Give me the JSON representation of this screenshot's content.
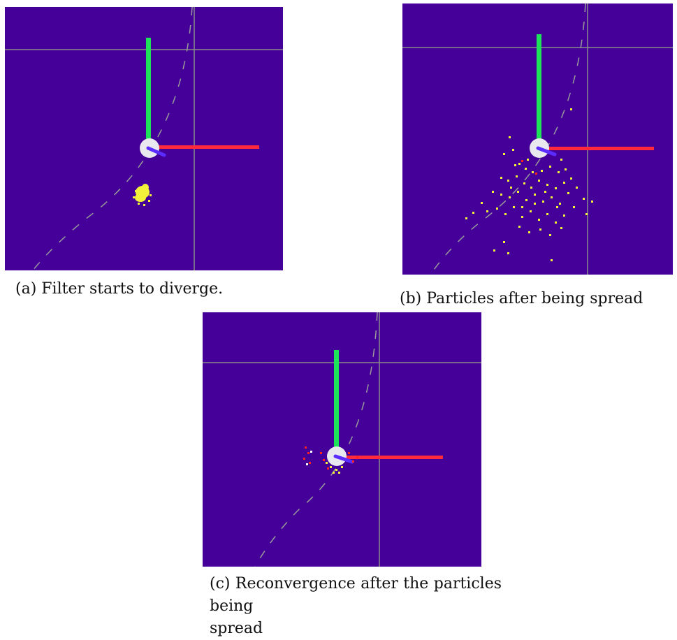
{
  "figure": {
    "colors": {
      "background": "#440099",
      "grid": "#8a8a8a",
      "trajectory": "#9a9a9a",
      "axis_vertical": "#1de25a",
      "axis_horizontal": "#ff2a3c",
      "robot_body": "#e8e8ee",
      "heading": "#5a2cff",
      "particle": "#f2f23a",
      "particle_red": "#ff2020"
    },
    "panels": [
      {
        "id": "a",
        "caption": "(a) Filter starts to diverge."
      },
      {
        "id": "b",
        "caption": "(b) Particles after being spread"
      },
      {
        "id": "c",
        "caption_line1": "(c) Reconvergence after the particles being",
        "caption_line2": "spread"
      }
    ]
  }
}
